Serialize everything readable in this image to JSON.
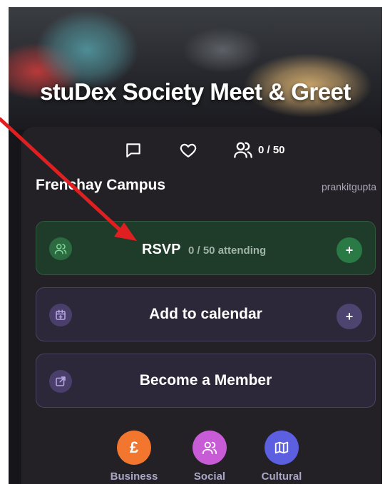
{
  "event": {
    "title": "stuDex Society Meet & Greet",
    "attendance": "0 / 50",
    "location": "Frenchay Campus",
    "organizer": "prankitgupta"
  },
  "actions": {
    "rsvp_label": "RSVP",
    "rsvp_sub": "0 / 50 attending",
    "rsvp_add": "+",
    "calendar_label": "Add to calendar",
    "calendar_add": "+",
    "member_label": "Become a Member"
  },
  "categories": [
    {
      "label": "Business",
      "icon": "pound-icon",
      "color": "#f2762e"
    },
    {
      "label": "Social",
      "icon": "people-icon",
      "color": "#c85bd6"
    },
    {
      "label": "Cultural",
      "icon": "map-icon",
      "color": "#5b5fe0"
    }
  ],
  "colors": {
    "background": "#16151a",
    "card": "#232126",
    "rsvp_green": "#2a7a45",
    "purple_button": "#2c2839",
    "annotation_arrow": "#e02020"
  }
}
